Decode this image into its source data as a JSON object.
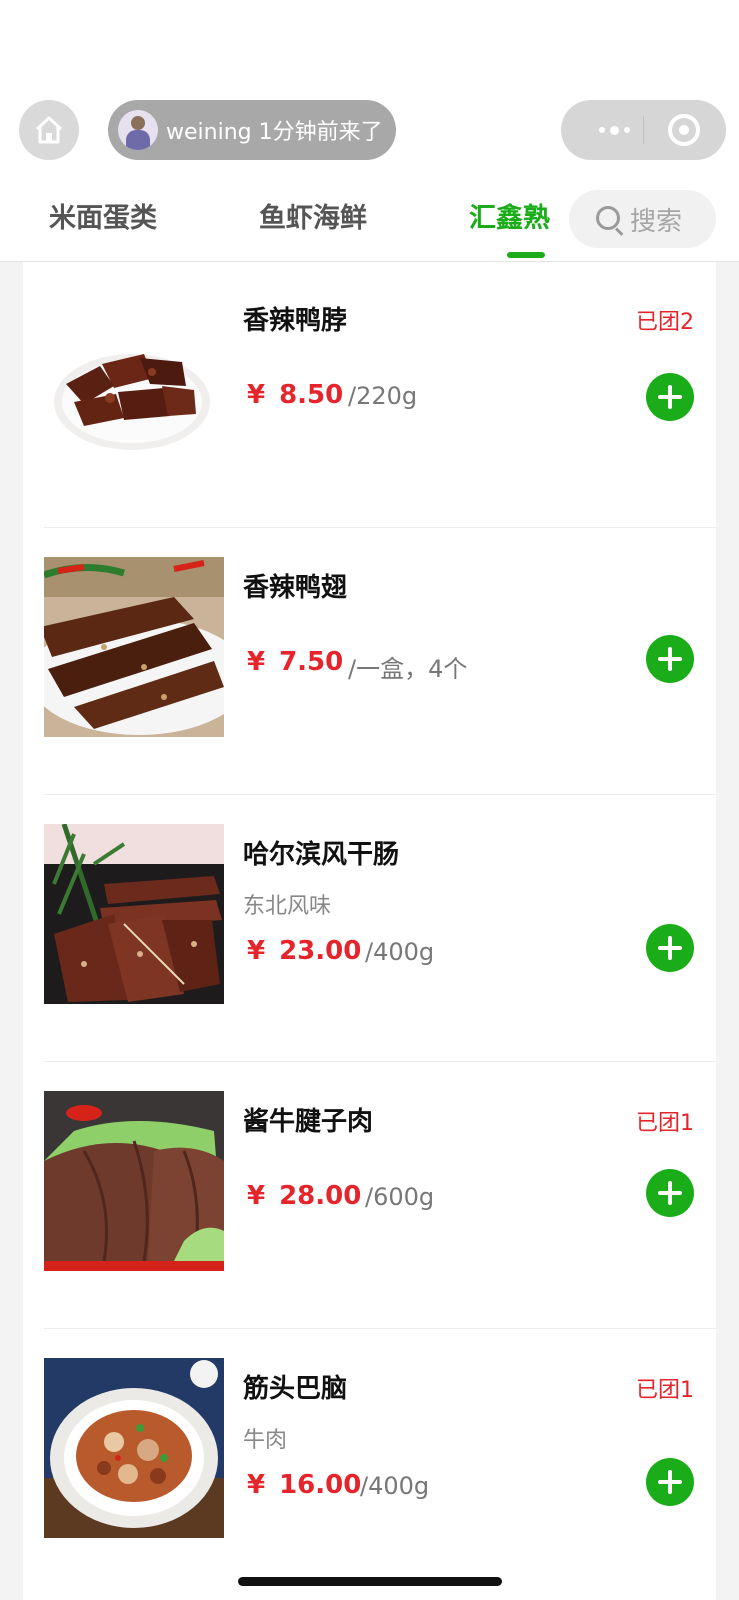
{
  "visitor": {
    "text": "weining 1分钟前来了"
  },
  "tabs": [
    {
      "label": "米面蛋类"
    },
    {
      "label": "鱼虾海鲜"
    },
    {
      "label": "汇鑫熟"
    }
  ],
  "search": {
    "placeholder": "搜索"
  },
  "colors": {
    "accent": "#1aad19",
    "price": "#e5242b"
  },
  "products": [
    {
      "name": "香辣鸭脖",
      "subtitle": "",
      "currency": "¥",
      "price": "8.50",
      "unit": "/220g",
      "tag": "已团2"
    },
    {
      "name": "香辣鸭翅",
      "subtitle": "",
      "currency": "¥",
      "price": "7.50",
      "unit": "/一盒，4个",
      "tag": ""
    },
    {
      "name": "哈尔滨风干肠",
      "subtitle": "东北风味",
      "currency": "¥",
      "price": "23.00",
      "unit": "/400g",
      "tag": ""
    },
    {
      "name": "酱牛腱子肉",
      "subtitle": "",
      "currency": "¥",
      "price": "28.00",
      "unit": "/600g",
      "tag": "已团1"
    },
    {
      "name": "筋头巴脑",
      "subtitle": "牛肉",
      "currency": "¥",
      "price": "16.00",
      "unit": "/400g",
      "tag": "已团1"
    }
  ]
}
